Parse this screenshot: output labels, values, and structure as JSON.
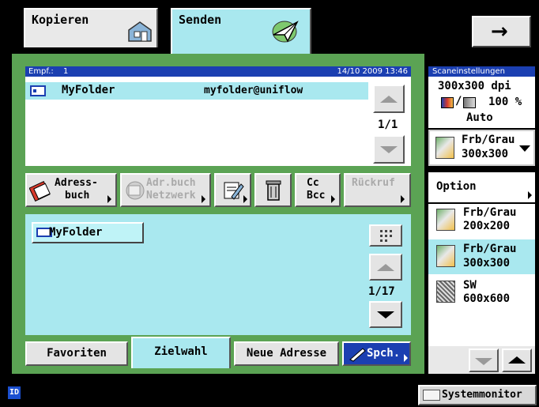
{
  "tabs": {
    "copy_label": "Kopieren",
    "send_label": "Senden"
  },
  "next_button_symbol": "→",
  "recipient": {
    "header_label": "Empf.:",
    "count": "1",
    "datetime": "14/10 2009 13:46",
    "row_name": "MyFolder",
    "row_address": "myfolder@uniflow",
    "page": "1/1"
  },
  "toolbar": {
    "address_book_line1": "Adress-",
    "address_book_line2": "buch",
    "network_book_line1": "Adr.buch",
    "network_book_line2": "Netzwerk",
    "cc_line1": "Cc",
    "cc_line2": "Bcc",
    "recall_label": "Rückruf"
  },
  "address_list": {
    "items": [
      "MyFolder"
    ],
    "page": "1/17"
  },
  "bottom_tabs": {
    "favorites": "Favoriten",
    "one_touch": "Zielwahl",
    "new_address": "Neue Adresse",
    "save": "Spch."
  },
  "scan_settings": {
    "header": "Scaneinstellungen",
    "resolution": "300x300 dpi",
    "zoom": "100 %",
    "mode": "Auto",
    "preset_line1": "Frb/Grau",
    "preset_line2": "300x300"
  },
  "options": {
    "label": "Option",
    "items": [
      {
        "line1": "Frb/Grau",
        "line2": "200x200"
      },
      {
        "line1": "Frb/Grau",
        "line2": "300x300"
      },
      {
        "line1": "SW",
        "line2": "600x600"
      }
    ]
  },
  "status": {
    "id_badge": "ID",
    "system_monitor": "Systemmonitor"
  },
  "colors": {
    "green": "#5ba354",
    "cyan": "#a9e8ef",
    "header_blue": "#1b3fb1"
  }
}
